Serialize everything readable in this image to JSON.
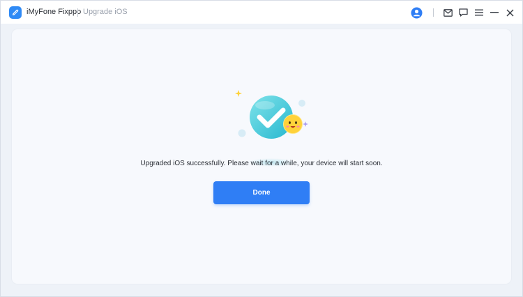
{
  "app": {
    "name": "iMyFone Fixppo",
    "page_title": "Upgrade iOS"
  },
  "titlebar": {
    "icons": [
      "user-account-icon",
      "mail-icon",
      "feedback-icon",
      "menu-icon",
      "minimize-icon",
      "close-icon"
    ]
  },
  "main": {
    "status_message": "Upgraded iOS successfully. Please wait for a while, your device will start soon.",
    "done_label": "Done"
  },
  "colors": {
    "accent": "#2f7ef5",
    "success": "#4fd0dc",
    "emoji": "#ffd23a"
  }
}
